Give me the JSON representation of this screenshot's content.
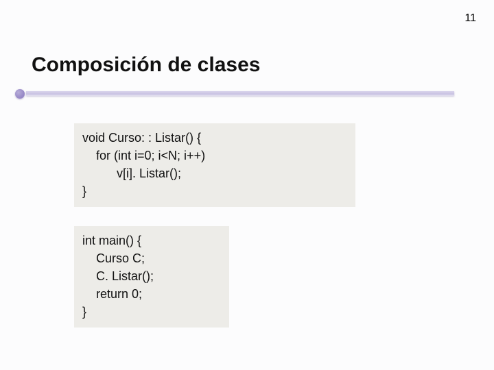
{
  "page_number": "11",
  "title": "Composición de clases",
  "code_block_1": {
    "lines": [
      "void Curso: : Listar() {",
      "    for (int i=0; i<N; i++)",
      "          v[i]. Listar();",
      "}"
    ]
  },
  "code_block_2": {
    "lines": [
      "int main() {",
      "    Curso C;",
      "    C. Listar();",
      "    return 0;",
      "}"
    ]
  }
}
